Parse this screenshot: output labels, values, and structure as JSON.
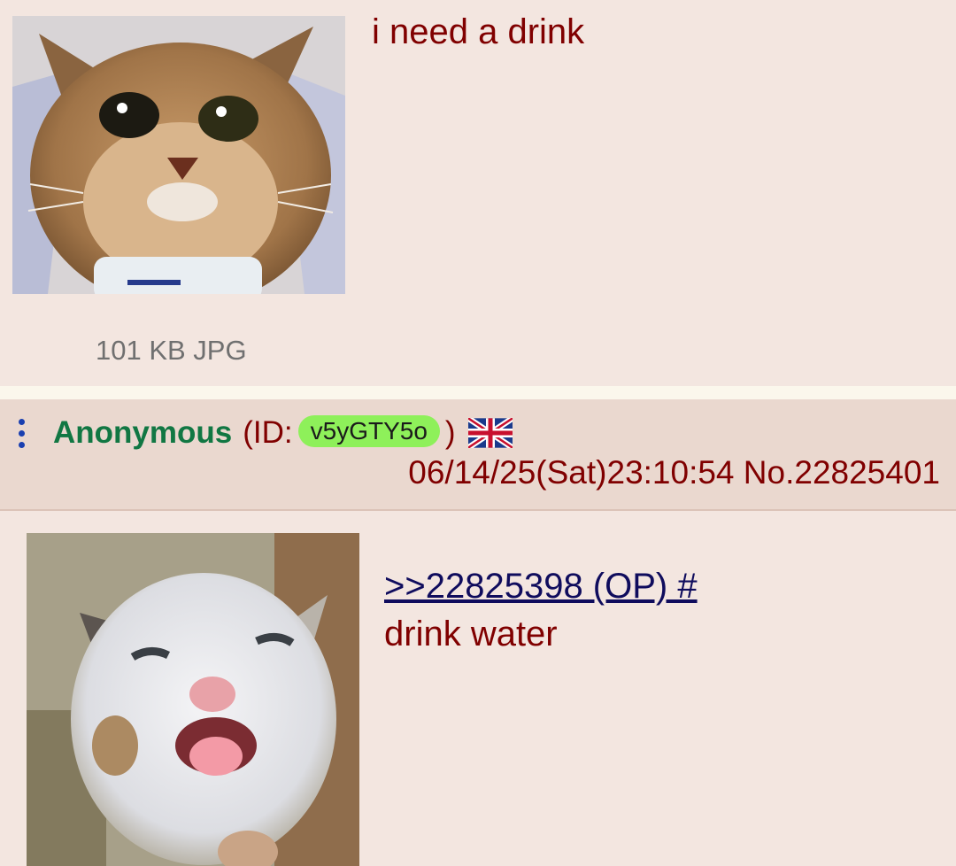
{
  "post_op": {
    "comment": "i need a drink",
    "file_info": "101 KB JPG"
  },
  "reply": {
    "name": "Anonymous",
    "id_prefix": "(ID:",
    "poster_id": "v5yGTY5o",
    "id_suffix": ")",
    "flag_icon": "uk-flag-icon",
    "datetime": "06/14/25(Sat)23:10:54",
    "post_number": "No.22825401",
    "quotelink": ">>22825398 (OP) #",
    "comment": "drink water"
  },
  "colors": {
    "background": "#f3e6e0",
    "header_bg": "#ead8cf",
    "name": "#117743",
    "text": "#800000",
    "link": "#0f0c5d",
    "id_badge": "#8ef05a"
  }
}
